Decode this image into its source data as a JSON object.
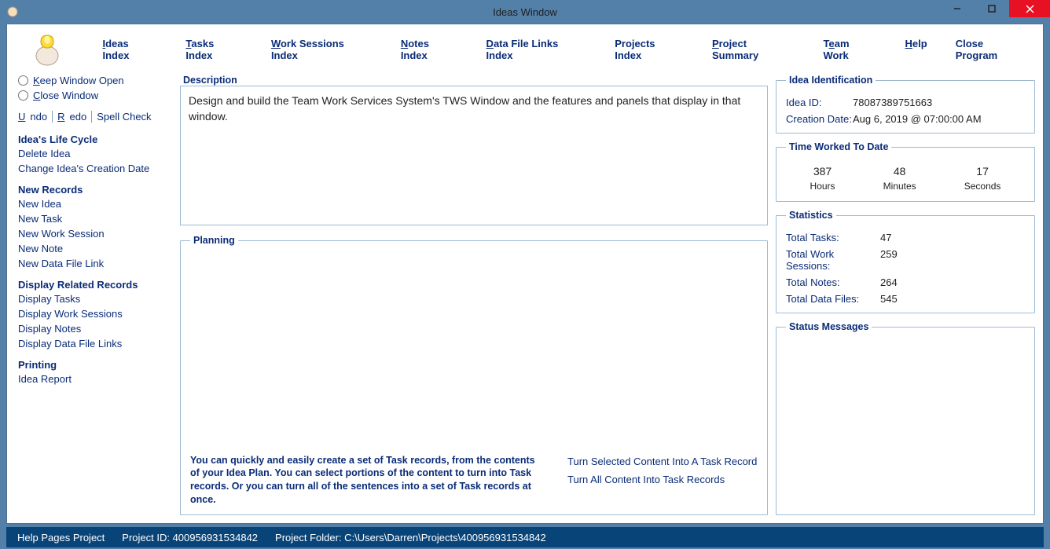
{
  "window": {
    "title": "Ideas Window"
  },
  "nav": {
    "ideas_index": "Ideas Index",
    "tasks_index": "Tasks Index",
    "work_sessions_index": "Work Sessions Index",
    "notes_index": "Notes Index",
    "data_file_links_index": "Data File Links Index",
    "projects_index": "Projects Index",
    "project_summary": "Project Summary",
    "team_work": "Team Work",
    "help": "Help",
    "close_program": "Close Program"
  },
  "sidebar": {
    "keep_open": "Keep Window Open",
    "close_window": "Close Window",
    "undo": "Undo",
    "redo": "Redo",
    "spell_check": "Spell Check",
    "heading_life_cycle": "Idea's Life Cycle",
    "delete_idea": "Delete Idea",
    "change_date": "Change Idea's Creation Date",
    "heading_new": "New Records",
    "new_idea": "New Idea",
    "new_task": "New Task",
    "new_work_session": "New Work Session",
    "new_note": "New Note",
    "new_dfl": "New Data File Link",
    "heading_display": "Display Related Records",
    "display_tasks": "Display Tasks",
    "display_ws": "Display Work Sessions",
    "display_notes": "Display Notes",
    "display_dfl": "Display Data File Links",
    "heading_print": "Printing",
    "idea_report": "Idea Report"
  },
  "description": {
    "legend": "Description",
    "text": "Design and build the Team Work Services System's TWS Window and the features and panels that display in that window."
  },
  "planning": {
    "legend": "Planning",
    "hint": "You can quickly and easily create a set of Task records, from the contents of your Idea Plan. You can select portions of the content to turn into Task records. Or you can turn all of the sentences into a set of Task records at once.",
    "turn_selected": "Turn Selected Content Into A Task Record",
    "turn_all": "Turn All Content Into Task Records"
  },
  "idea_id": {
    "legend": "Idea Identification",
    "id_label": "Idea ID:",
    "id_value": "78087389751663",
    "date_label": "Creation Date:",
    "date_value": "Aug  6, 2019 @ 07:00:00 AM"
  },
  "time_worked": {
    "legend": "Time Worked To Date",
    "hours": "387",
    "hours_label": "Hours",
    "minutes": "48",
    "minutes_label": "Minutes",
    "seconds": "17",
    "seconds_label": "Seconds"
  },
  "stats": {
    "legend": "Statistics",
    "total_tasks_label": "Total Tasks:",
    "total_tasks": "47",
    "total_ws_label": "Total Work Sessions:",
    "total_ws": "259",
    "total_notes_label": "Total Notes:",
    "total_notes": "264",
    "total_df_label": "Total Data Files:",
    "total_df": "545"
  },
  "status_msgs": {
    "legend": "Status Messages"
  },
  "statusbar": {
    "help_pages": "Help Pages Project",
    "project_id": "Project ID: 400956931534842",
    "project_folder": "Project Folder: C:\\Users\\Darren\\Projects\\400956931534842"
  }
}
